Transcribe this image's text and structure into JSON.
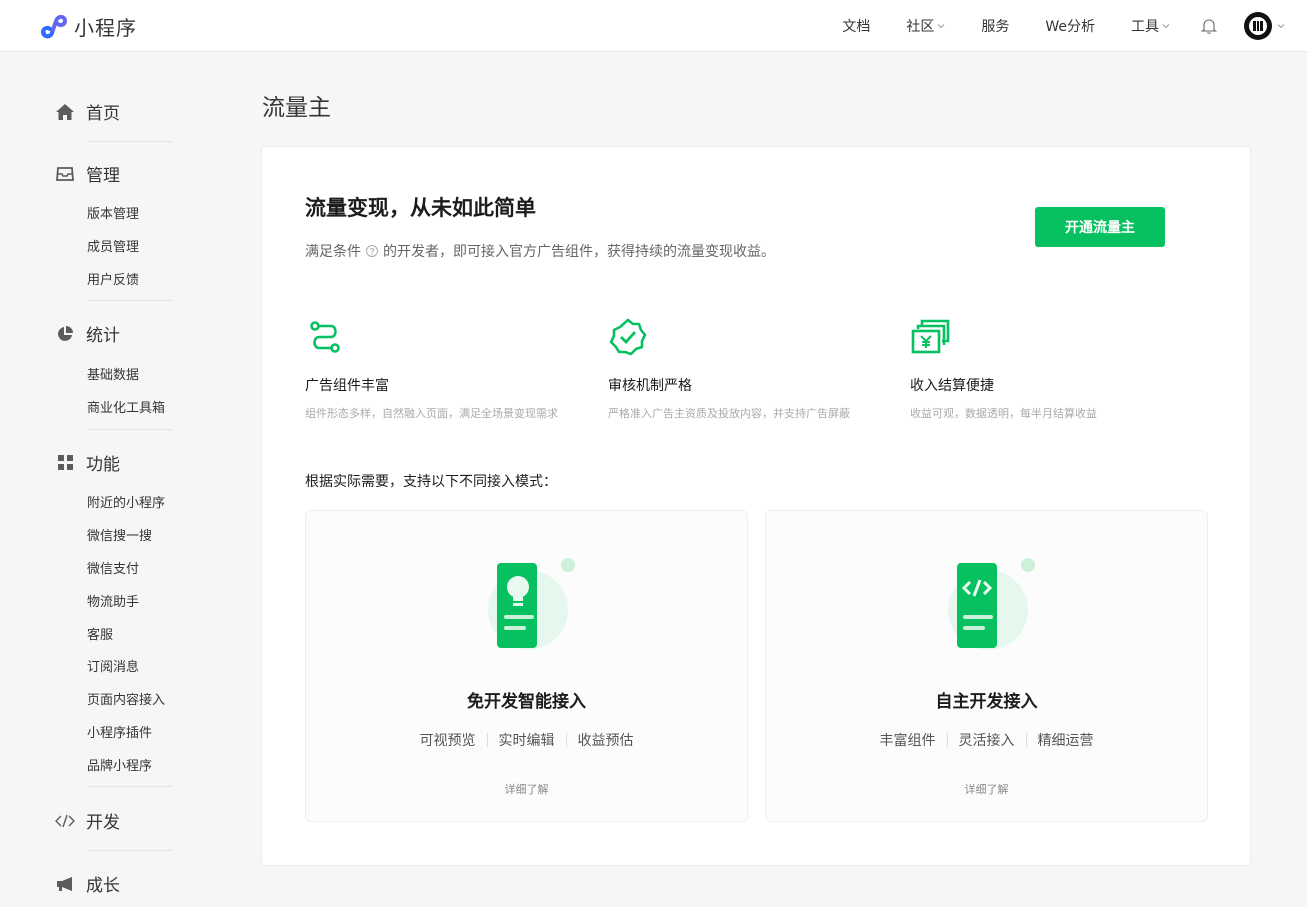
{
  "header": {
    "logo_text": "小程序",
    "nav": [
      {
        "label": "文档",
        "has_dropdown": false
      },
      {
        "label": "社区",
        "has_dropdown": true
      },
      {
        "label": "服务",
        "has_dropdown": false
      },
      {
        "label": "We分析",
        "has_dropdown": false
      },
      {
        "label": "工具",
        "has_dropdown": true
      }
    ],
    "icons": {
      "bell": "bell-icon",
      "avatar": "user-avatar"
    }
  },
  "sidebar": {
    "home": {
      "label": "首页",
      "icon": "home-icon"
    },
    "manage": {
      "label": "管理",
      "icon": "inbox-icon",
      "items": [
        "版本管理",
        "成员管理",
        "用户反馈"
      ]
    },
    "stats": {
      "label": "统计",
      "icon": "pie-chart-icon",
      "items": [
        "基础数据",
        "商业化工具箱"
      ]
    },
    "features": {
      "label": "功能",
      "icon": "grid-icon",
      "items": [
        "附近的小程序",
        "微信搜一搜",
        "微信支付",
        "物流助手",
        "客服",
        "订阅消息",
        "页面内容接入",
        "小程序插件",
        "品牌小程序"
      ]
    },
    "develop": {
      "label": "开发",
      "icon": "code-icon"
    },
    "growth": {
      "label": "成长",
      "icon": "megaphone-icon"
    }
  },
  "main": {
    "page_title": "流量主",
    "hero": {
      "title": "流量变现，从未如此简单",
      "desc_before": "满足条件",
      "desc_after": "的开发者，即可接入官方广告组件，获得持续的流量变现收益。",
      "button_label": "开通流量主"
    },
    "features": [
      {
        "title": "广告组件丰富",
        "desc": "组件形态多样，自然融入页面，满足全场景变现需求",
        "icon": "route-icon"
      },
      {
        "title": "审核机制严格",
        "desc": "严格准入广告主资质及投放内容，并支持广告屏蔽",
        "icon": "verified-badge-icon"
      },
      {
        "title": "收入结算便捷",
        "desc": "收益可观，数据透明，每半月结算收益",
        "icon": "yuan-cards-icon"
      }
    ],
    "mode_heading": "根据实际需要，支持以下不同接入模式：",
    "modes": [
      {
        "title": "免开发智能接入",
        "tags": [
          "可视预览",
          "实时编辑",
          "收益预估"
        ],
        "more": "详细了解",
        "icon": "lightbulb-doc-icon"
      },
      {
        "title": "自主开发接入",
        "tags": [
          "丰富组件",
          "灵活接入",
          "精细运营"
        ],
        "more": "详细了解",
        "icon": "code-doc-icon"
      }
    ]
  },
  "colors": {
    "brand_green": "#07c160",
    "logo_purple": "#6467f0",
    "logo_blue": "#2e6bff"
  }
}
